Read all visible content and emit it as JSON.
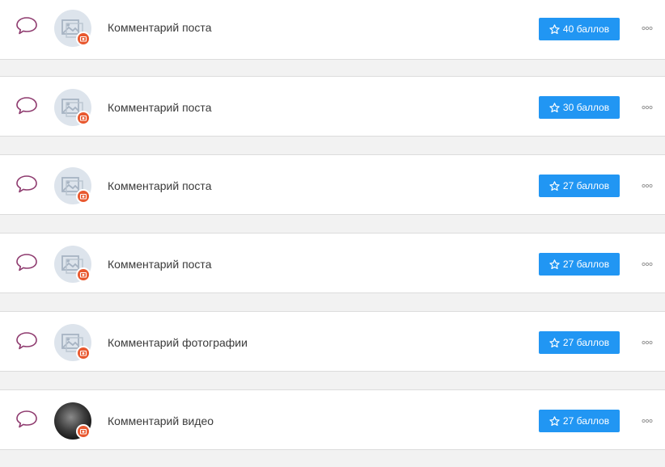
{
  "accent_color": "#2196f3",
  "comment_icon_color": "#8e3a6e",
  "badge_color": "#e8582f",
  "tasks": [
    {
      "icon": "comment-icon",
      "avatar": "image-placeholder",
      "label": "Комментарий поста",
      "points_label": "40 баллов",
      "points": 40
    },
    {
      "icon": "comment-icon",
      "avatar": "image-placeholder",
      "label": "Комментарий поста",
      "points_label": "30 баллов",
      "points": 30
    },
    {
      "icon": "comment-icon",
      "avatar": "image-placeholder",
      "label": "Комментарий поста",
      "points_label": "27 баллов",
      "points": 27
    },
    {
      "icon": "comment-icon",
      "avatar": "image-placeholder",
      "label": "Комментарий поста",
      "points_label": "27 баллов",
      "points": 27
    },
    {
      "icon": "comment-icon",
      "avatar": "image-placeholder",
      "label": "Комментарий фотографии",
      "points_label": "27 баллов",
      "points": 27
    },
    {
      "icon": "comment-icon",
      "avatar": "user-photo",
      "label": "Комментарий видео",
      "points_label": "27 баллов",
      "points": 27
    }
  ]
}
